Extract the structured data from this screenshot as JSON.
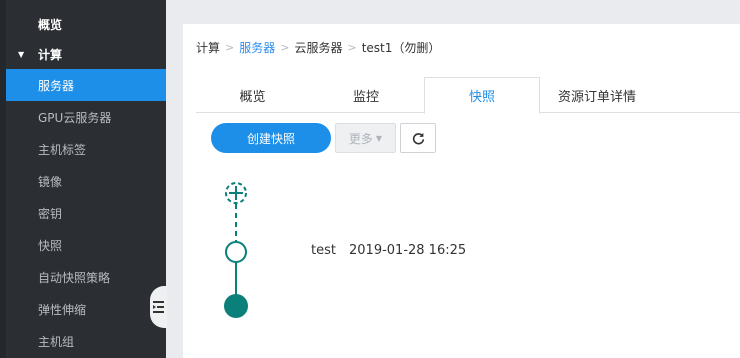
{
  "sidebar": {
    "overview": "概览",
    "group_compute": "计算",
    "items": [
      {
        "label": "服务器",
        "active": true
      },
      {
        "label": "GPU云服务器"
      },
      {
        "label": "主机标签"
      },
      {
        "label": "镜像"
      },
      {
        "label": "密钥"
      },
      {
        "label": "快照"
      },
      {
        "label": "自动快照策略"
      },
      {
        "label": "弹性伸缩"
      },
      {
        "label": "主机组"
      }
    ]
  },
  "breadcrumb": {
    "items": [
      "计算",
      "服务器",
      "云服务器",
      "test1（勿删）"
    ],
    "separator": ">"
  },
  "tabs": [
    {
      "label": "概览"
    },
    {
      "label": "监控"
    },
    {
      "label": "快照",
      "active": true
    },
    {
      "label": "资源订单详情"
    }
  ],
  "toolbar": {
    "create_label": "创建快照",
    "more_label": "更多",
    "refresh_icon": "refresh-icon"
  },
  "snapshots": [
    {
      "name": "test",
      "time": "2019-01-28 16:25"
    }
  ],
  "colors": {
    "accent": "#1e8fe9",
    "sidebar_bg": "#2b2e33",
    "timeline": "#0b7f7a"
  }
}
